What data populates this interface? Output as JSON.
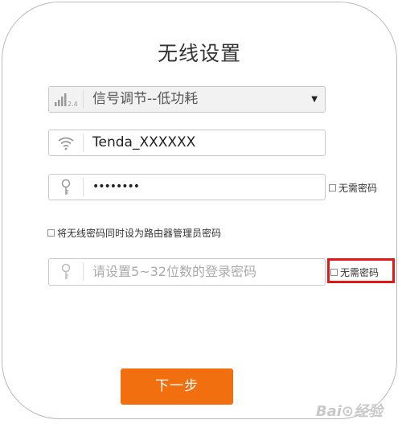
{
  "page": {
    "title": "无线设置"
  },
  "signal": {
    "label": "信号调节--低功耗",
    "icon_badge": "2.4"
  },
  "ssid": {
    "value": "Tenda_XXXXXX"
  },
  "wifi_password": {
    "masked_value": "••••••••",
    "no_password_label": "无需密码"
  },
  "sync_option": {
    "label": "将无线密码同时设为路由器管理员密码"
  },
  "admin_password": {
    "placeholder": "请设置5~32位数的登录密码",
    "no_password_label": "无需密码"
  },
  "actions": {
    "next_label": "下一步"
  },
  "watermark": {
    "text": "Bai⊙经验"
  },
  "colors": {
    "accent": "#f16f0f",
    "highlight": "#e01818"
  }
}
